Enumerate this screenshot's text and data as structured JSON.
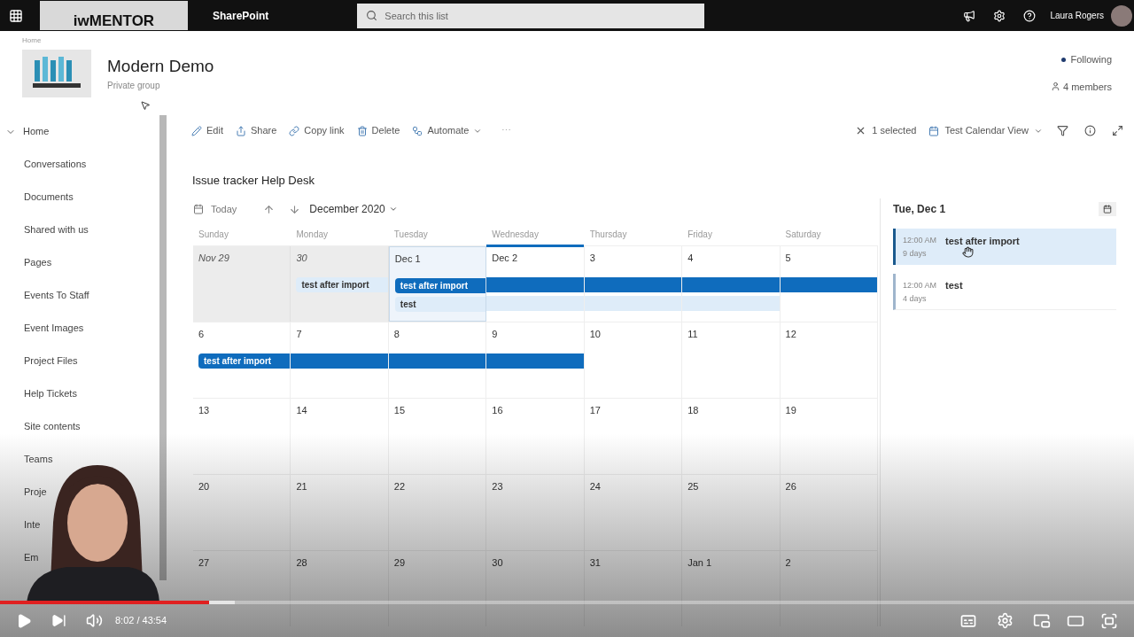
{
  "top_bar": {
    "logo": "iwMENTOR",
    "app": "SharePoint",
    "search": {
      "placeholder": "Search this list"
    },
    "user": "Laura Rogers"
  },
  "site": {
    "breadcrumb": "Home",
    "title": "Modern Demo",
    "subtitle": "Private group",
    "follow": "Following",
    "members": "4 members"
  },
  "nav": {
    "home": {
      "label": "Home",
      "expanded": true
    },
    "items": [
      {
        "label": "Conversations"
      },
      {
        "label": "Documents"
      },
      {
        "label": "Shared with us"
      },
      {
        "label": "Pages"
      },
      {
        "label": "Events To Staff"
      },
      {
        "label": "Event Images"
      },
      {
        "label": "Project Files"
      },
      {
        "label": "Help Tickets"
      },
      {
        "label": "Site contents"
      },
      {
        "label": "Teams"
      },
      {
        "label": "Proje"
      },
      {
        "label": "Inte"
      },
      {
        "label": "Em"
      }
    ]
  },
  "command_bar": {
    "left": [
      {
        "kind": "edit",
        "label": "Edit"
      },
      {
        "kind": "share",
        "label": "Share"
      },
      {
        "kind": "link",
        "label": "Copy link"
      },
      {
        "kind": "delete",
        "label": "Delete"
      },
      {
        "kind": "automate",
        "label": "Automate"
      },
      {
        "kind": "more",
        "label": "⋯"
      }
    ],
    "selected_count": "1 selected",
    "view": "Test Calendar View"
  },
  "list_title": "Issue tracker Help Desk",
  "calendar": {
    "today_button": "Today",
    "month": "December 2020",
    "weekdays": [
      "Sunday",
      "Monday",
      "Tuesday",
      "Wednesday",
      "Thursday",
      "Friday",
      "Saturday"
    ],
    "weeks": [
      [
        {
          "label": "Nov 29",
          "selected": false,
          "today": false,
          "muted": true
        },
        {
          "label": "30",
          "selected": false,
          "today": false,
          "muted": true,
          "events": [
            {
              "kind": "start",
              "title": "test after import",
              "selected": false
            }
          ]
        },
        {
          "label": "Dec 1",
          "selected": true,
          "today": false,
          "muted": false,
          "events": [
            {
              "kind": "start",
              "title": "test after import",
              "selected": true
            },
            {
              "kind": "start",
              "title": "test",
              "selected": false
            }
          ]
        },
        {
          "label": "Dec 2",
          "selected": false,
          "today": true,
          "muted": false,
          "events": [
            {
              "kind": "continue",
              "selected": true
            },
            {
              "kind": "continue",
              "selected": false
            }
          ]
        },
        {
          "label": "3",
          "selected": false,
          "today": false,
          "muted": false,
          "events": [
            {
              "kind": "continue",
              "selected": true
            },
            {
              "kind": "continue",
              "selected": false
            }
          ]
        },
        {
          "label": "4",
          "selected": false,
          "today": false,
          "muted": false,
          "events": [
            {
              "kind": "continue",
              "selected": true
            },
            {
              "kind": "continue",
              "selected": false
            }
          ]
        },
        {
          "label": "5",
          "selected": false,
          "today": false,
          "muted": false,
          "events": [
            {
              "kind": "continue",
              "selected": true
            }
          ]
        }
      ],
      [
        {
          "label": "6",
          "selected": false,
          "today": false,
          "muted": false,
          "events": [
            {
              "kind": "start",
              "title": "test after import",
              "selected": true
            }
          ]
        },
        {
          "label": "7",
          "selected": false,
          "today": false,
          "muted": false,
          "events": [
            {
              "kind": "continue",
              "selected": true
            }
          ]
        },
        {
          "label": "8",
          "selected": false,
          "today": false,
          "muted": false,
          "events": [
            {
              "kind": "continue",
              "selected": true
            }
          ]
        },
        {
          "label": "9",
          "selected": false,
          "today": false,
          "muted": false,
          "events": [
            {
              "kind": "continue",
              "selected": true
            }
          ]
        },
        {
          "label": "10",
          "selected": false,
          "today": false,
          "muted": false
        },
        {
          "label": "11",
          "selected": false,
          "today": false,
          "muted": false
        },
        {
          "label": "12",
          "selected": false,
          "today": false,
          "muted": false
        }
      ],
      [
        {
          "label": "13",
          "selected": false,
          "today": false,
          "muted": false
        },
        {
          "label": "14",
          "selected": false,
          "today": false,
          "muted": false
        },
        {
          "label": "15",
          "selected": false,
          "today": false,
          "muted": false
        },
        {
          "label": "16",
          "selected": false,
          "today": false,
          "muted": false
        },
        {
          "label": "17",
          "selected": false,
          "today": false,
          "muted": false
        },
        {
          "label": "18",
          "selected": false,
          "today": false,
          "muted": false
        },
        {
          "label": "19",
          "selected": false,
          "today": false,
          "muted": false
        }
      ],
      [
        {
          "label": "20",
          "selected": false,
          "today": false,
          "muted": false
        },
        {
          "label": "21",
          "selected": false,
          "today": false,
          "muted": false
        },
        {
          "label": "22",
          "selected": false,
          "today": false,
          "muted": false
        },
        {
          "label": "23",
          "selected": false,
          "today": false,
          "muted": false
        },
        {
          "label": "24",
          "selected": false,
          "today": false,
          "muted": false
        },
        {
          "label": "25",
          "selected": false,
          "today": false,
          "muted": false
        },
        {
          "label": "26",
          "selected": false,
          "today": false,
          "muted": false
        }
      ],
      [
        {
          "label": "27",
          "selected": false,
          "today": false,
          "muted": false
        },
        {
          "label": "28",
          "selected": false,
          "today": false,
          "muted": false
        },
        {
          "label": "29",
          "selected": false,
          "today": false,
          "muted": false
        },
        {
          "label": "30",
          "selected": false,
          "today": false,
          "muted": false
        },
        {
          "label": "31",
          "selected": false,
          "today": false,
          "muted": false
        },
        {
          "label": "Jan 1",
          "selected": false,
          "today": false,
          "muted": false
        },
        {
          "label": "2",
          "selected": false,
          "today": false,
          "muted": false
        }
      ]
    ]
  },
  "agenda": {
    "date": "Tue, Dec 1",
    "items": [
      {
        "time": "12:00 AM",
        "title": "test after import",
        "duration": "9 days",
        "selected": true
      },
      {
        "time": "12:00 AM",
        "title": "test",
        "duration": "4 days",
        "selected": false
      }
    ]
  },
  "video": {
    "played": {
      "level": 0.184
    },
    "buffered": {
      "level": 0.207
    },
    "time": "8:02 / 43:54"
  }
}
